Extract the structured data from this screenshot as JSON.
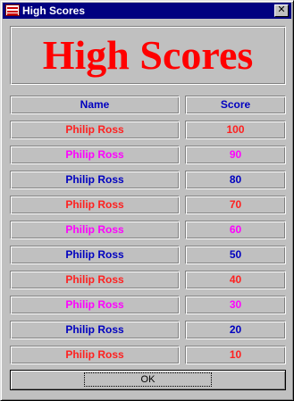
{
  "window": {
    "title": "High Scores",
    "close_glyph": "✕",
    "icon": "app-icon"
  },
  "banner": {
    "text": "High Scores",
    "color": "#ff0000"
  },
  "table": {
    "headers": {
      "name": "Name",
      "score": "Score",
      "color": "#0000c0"
    },
    "rows": [
      {
        "name": "Philip Ross",
        "score": "100",
        "color": "#ff2020"
      },
      {
        "name": "Philip Ross",
        "score": "90",
        "color": "#ff00ff"
      },
      {
        "name": "Philip Ross",
        "score": "80",
        "color": "#0000c0"
      },
      {
        "name": "Philip Ross",
        "score": "70",
        "color": "#ff2020"
      },
      {
        "name": "Philip Ross",
        "score": "60",
        "color": "#ff00ff"
      },
      {
        "name": "Philip Ross",
        "score": "50",
        "color": "#0000c0"
      },
      {
        "name": "Philip Ross",
        "score": "40",
        "color": "#ff2020"
      },
      {
        "name": "Philip Ross",
        "score": "30",
        "color": "#ff00ff"
      },
      {
        "name": "Philip Ross",
        "score": "20",
        "color": "#0000c0"
      },
      {
        "name": "Philip Ross",
        "score": "10",
        "color": "#ff2020"
      }
    ]
  },
  "ok_button": {
    "label": "OK"
  }
}
